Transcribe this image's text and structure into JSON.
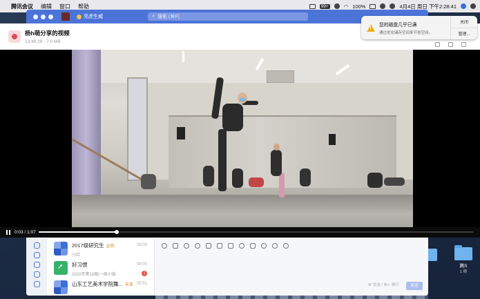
{
  "menubar": {
    "items": [
      "腾讯会议",
      "编辑",
      "窗口",
      "帮助"
    ],
    "badge": "99+",
    "battery": "100%",
    "clock": "4月4日 周日 下午2:28:41"
  },
  "chat": {
    "status": "亮虎生威",
    "search_placeholder": "搜索 (⌘F)",
    "list": [
      {
        "name": "2017级研究生",
        "tag": "@我",
        "sub": "小红",
        "time": "08:00"
      },
      {
        "name": "好习惯",
        "tag": "",
        "sub": "2022年第13周|一周小结",
        "time": "08:00",
        "badge": "1"
      },
      {
        "name": "山东工艺美术学院舞...",
        "tag": "未读",
        "sub": "",
        "time": "05:51"
      }
    ],
    "compose_hint": "⌘ 发送 / ⌘↵ 换行",
    "send_label": "发送"
  },
  "viewer": {
    "title": "杨h萌分享的视频",
    "meta": "13:48:29 · 7.0 MB",
    "time": "0:03 / 1:07",
    "progress": 0.18
  },
  "notification": {
    "title": "您的磁盘几乎已满",
    "body": "通过优化储存空间来节省空间。",
    "close_label": "关闭",
    "manage_label": "管理..."
  },
  "desktop": {
    "folder_name": "腾S",
    "folder_sub": "1 项"
  },
  "colors": {
    "chat_accent": "#4b73d8",
    "warning": "#f2b01e"
  }
}
